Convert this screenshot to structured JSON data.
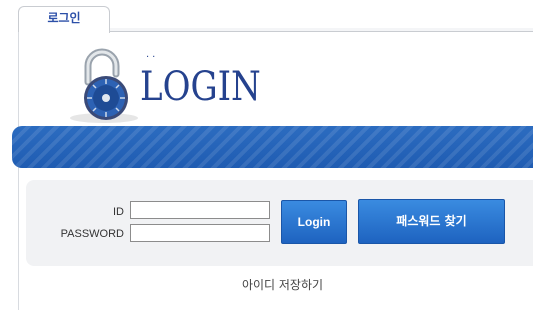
{
  "tab": {
    "label": "로그인"
  },
  "logo": {
    "dots": "··",
    "text": "LOGIN"
  },
  "form": {
    "id_label": "ID",
    "password_label": "PASSWORD",
    "id_value": "",
    "password_value": "",
    "login_button": "Login",
    "find_password_button": "패스워드 찾기",
    "save_id_label": "아이디 저장하기"
  },
  "colors": {
    "accent": "#2c6cc0",
    "logo": "#25428e",
    "form_bg": "#f1f2f4"
  }
}
